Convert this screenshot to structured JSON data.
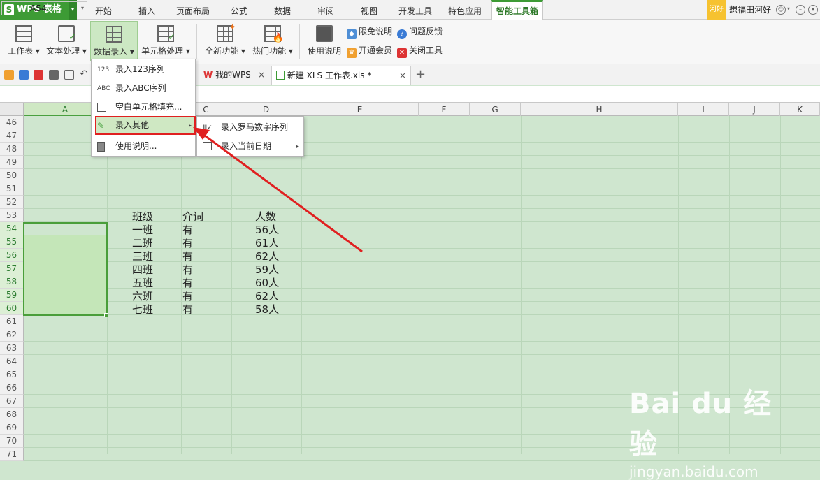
{
  "app": {
    "logo_text": "WPS 表格"
  },
  "menu_tabs": [
    {
      "label": "开始"
    },
    {
      "label": "插入"
    },
    {
      "label": "页面布局"
    },
    {
      "label": "公式"
    },
    {
      "label": "数据"
    },
    {
      "label": "审阅"
    },
    {
      "label": "视图"
    },
    {
      "label": "开发工具"
    },
    {
      "label": "特色应用"
    },
    {
      "label": "智能工具箱"
    }
  ],
  "user": {
    "avatar_text": "河好",
    "name": "想福田河好"
  },
  "ribbon": {
    "buttons": [
      {
        "label": "工作表 ▾"
      },
      {
        "label": "文本处理 ▾"
      },
      {
        "label": "数据录入 ▾"
      },
      {
        "label": "单元格处理 ▾"
      },
      {
        "label": "全新功能 ▾"
      },
      {
        "label": "热门功能 ▾"
      },
      {
        "label": "使用说明"
      }
    ],
    "small": {
      "disclaimer": "限免说明",
      "feedback": "问题反馈",
      "vip": "开通会员",
      "close": "关闭工具"
    }
  },
  "doc_tabs": [
    {
      "label": "我的WPS"
    },
    {
      "label": "新建 XLS 工作表.xls *"
    }
  ],
  "namebox": {
    "value": "A54"
  },
  "columns": [
    "A",
    "B",
    "C",
    "D",
    "E",
    "F",
    "G",
    "H",
    "I",
    "J",
    "K"
  ],
  "rows": [
    "46",
    "47",
    "48",
    "49",
    "50",
    "51",
    "52",
    "53",
    "54",
    "55",
    "56",
    "57",
    "58",
    "59",
    "60",
    "61",
    "62",
    "63",
    "64",
    "65",
    "66",
    "67",
    "68",
    "69",
    "70",
    "71"
  ],
  "table": {
    "header": [
      "班级",
      "介词",
      "人数"
    ],
    "rows": [
      [
        "一班",
        "有",
        "56人"
      ],
      [
        "二班",
        "有",
        "61人"
      ],
      [
        "三班",
        "有",
        "62人"
      ],
      [
        "四班",
        "有",
        "59人"
      ],
      [
        "五班",
        "有",
        "60人"
      ],
      [
        "六班",
        "有",
        "62人"
      ],
      [
        "七班",
        "有",
        "58人"
      ]
    ]
  },
  "dropdown": {
    "items": [
      {
        "label": "录入123序列",
        "icon": "123"
      },
      {
        "label": "录入ABC序列",
        "icon": "ABC"
      },
      {
        "label": "空白单元格填充...",
        "icon": "grid"
      },
      {
        "label": "录入其他",
        "icon": "pencil"
      },
      {
        "label": "使用说明...",
        "icon": "doc"
      }
    ],
    "submenu": [
      {
        "label": "录入罗马数字序列",
        "icon": "roman"
      },
      {
        "label": "录入当前日期",
        "icon": "calendar"
      }
    ]
  },
  "watermark": {
    "brand": "Bai du 经验",
    "url": "jingyan.baidu.com"
  },
  "colors": {
    "accent": "#3d9b35",
    "grid_bg": "#cfe6cf",
    "highlight_red": "#e02020"
  }
}
